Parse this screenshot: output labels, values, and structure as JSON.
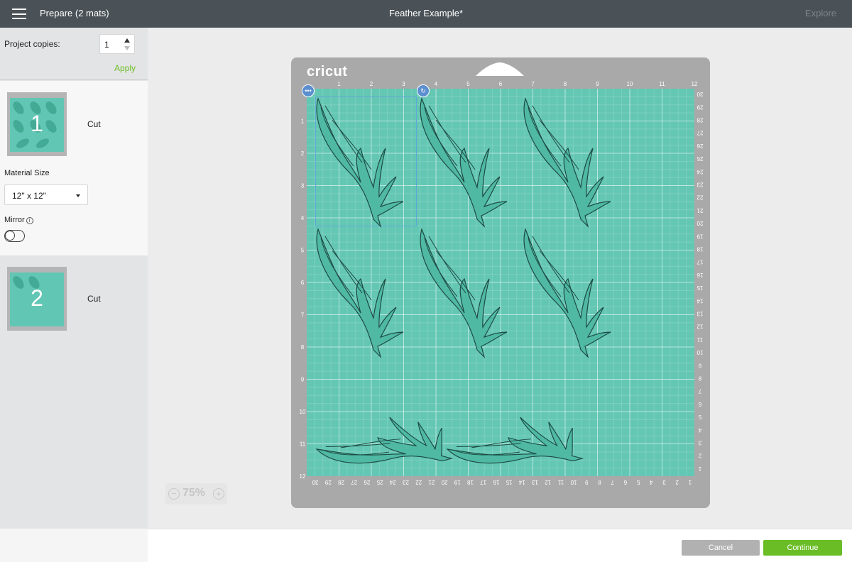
{
  "header": {
    "menu_icon": "hamburger-icon",
    "title": "Prepare (2 mats)",
    "project_name": "Feather Example*",
    "explore_label": "Explore"
  },
  "sidebar": {
    "copies_label": "Project copies:",
    "copies_value": "1",
    "apply_label": "Apply",
    "mats": [
      {
        "number": "1",
        "label": "Cut"
      },
      {
        "number": "2",
        "label": "Cut"
      }
    ],
    "material_size_label": "Material Size",
    "material_size_value": "12\" x 12\"",
    "mirror_label": "Mirror",
    "mirror_info_icon": "info-icon",
    "mirror_on": false
  },
  "canvas": {
    "brand": "cricut",
    "top_ruler": [
      "1",
      "2",
      "3",
      "4",
      "5",
      "6",
      "7",
      "8",
      "9",
      "10",
      "11",
      "12"
    ],
    "left_ruler": [
      "1",
      "2",
      "3",
      "4",
      "5",
      "6",
      "7",
      "8",
      "9",
      "10",
      "11",
      "12"
    ],
    "bottom_ruler": [
      "30",
      "29",
      "28",
      "27",
      "26",
      "25",
      "24",
      "23",
      "22",
      "21",
      "20",
      "19",
      "18",
      "17",
      "16",
      "15",
      "14",
      "13",
      "12",
      "11",
      "10",
      "9",
      "8",
      "7",
      "6",
      "5",
      "4",
      "3",
      "2",
      "1"
    ],
    "right_ruler": [
      "30",
      "29",
      "28",
      "27",
      "26",
      "25",
      "24",
      "23",
      "22",
      "21",
      "20",
      "19",
      "18",
      "17",
      "16",
      "15",
      "14",
      "13",
      "12",
      "11",
      "10",
      "9",
      "8",
      "7",
      "6",
      "5",
      "4",
      "3",
      "2",
      "1"
    ],
    "handle_more_icon": "more-icon",
    "handle_rotate_icon": "rotate-icon",
    "zoom_value": "75%",
    "zoom_out_icon": "zoom-out-icon",
    "zoom_in_icon": "zoom-in-icon",
    "mat_color": "#64c7b4",
    "feather_color": "#3d9e8b"
  },
  "footer": {
    "cancel_label": "Cancel",
    "continue_label": "Continue"
  }
}
